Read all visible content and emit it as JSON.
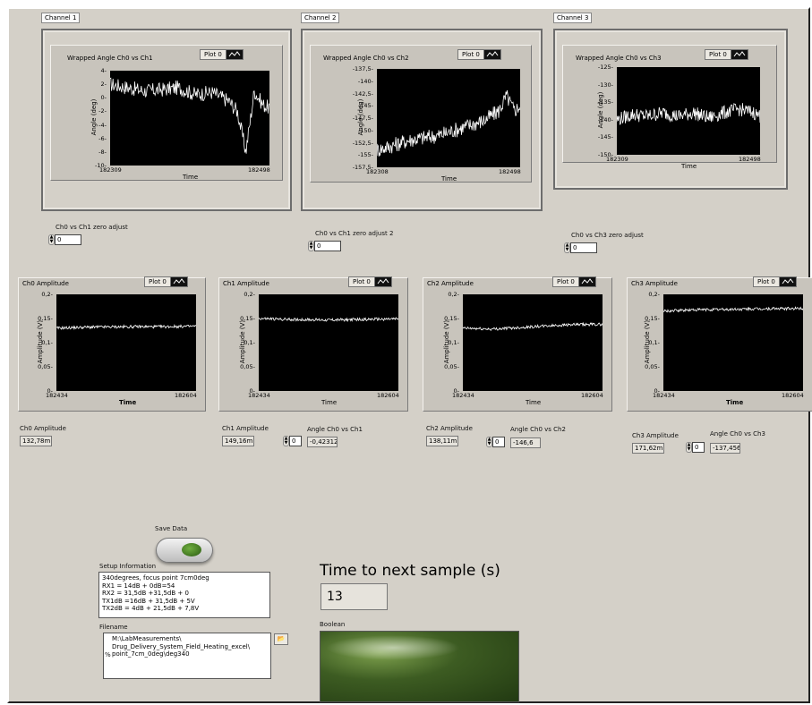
{
  "channels": [
    {
      "label": "Channel 1",
      "graph_title": "Wrapped Angle Ch0 vs Ch1",
      "plot_legend": "Plot 0",
      "ylabel": "Angle (deg)",
      "xlabel": "Time",
      "yticks": [
        "4",
        "2",
        "0",
        "-2",
        "-4",
        "-6",
        "-8",
        "-10"
      ],
      "xticks": [
        "182309",
        "182498"
      ],
      "zero_label": "Ch0 vs Ch1 zero adjust",
      "zero_value": "0"
    },
    {
      "label": "Channel 2",
      "graph_title": "Wrapped Angle Ch0 vs Ch2",
      "plot_legend": "Plot 0",
      "ylabel": "Angle (deg)",
      "xlabel": "Time",
      "yticks": [
        "-137,5",
        "-140",
        "-142,5",
        "-145",
        "-147,5",
        "-150",
        "-152,5",
        "-155",
        "-157,5"
      ],
      "xticks": [
        "182308",
        "182498"
      ],
      "zero_label": "Ch0 vs Ch1 zero adjust 2",
      "zero_value": "0"
    },
    {
      "label": "Channel 3",
      "graph_title": "Wrapped Angle Ch0 vs Ch3",
      "plot_legend": "Plot 0",
      "ylabel": "Angle (deg)",
      "xlabel": "Time",
      "yticks": [
        "-125",
        "-130",
        "-135",
        "-140",
        "-145",
        "-150"
      ],
      "xticks": [
        "182309",
        "182498"
      ],
      "zero_label": "Ch0 vs Ch3 zero adjust",
      "zero_value": "0"
    }
  ],
  "amplitudes": [
    {
      "graph_title": "Ch0 Amplitude",
      "plot_legend": "Plot 0",
      "ylabel": "Amplitude (V)",
      "xlabel": "Time",
      "yticks": [
        "0,2",
        "0,15",
        "0,1",
        "0,05",
        "0"
      ],
      "xticks": [
        "182434",
        "182604"
      ],
      "indicator_label": "Ch0 Amplitude",
      "indicator_value": "132,78m"
    },
    {
      "graph_title": "Ch1 Amplitude",
      "plot_legend": "Plot 0",
      "ylabel": "Amplitude (V)",
      "xlabel": "Time",
      "yticks": [
        "0,2",
        "0,15",
        "0,1",
        "0,05",
        "0"
      ],
      "xticks": [
        "182434",
        "182604"
      ],
      "indicator_label": "Ch1 Amplitude",
      "indicator_value": "149,16m",
      "angle_label": "Angle Ch0 vs Ch1",
      "angle_ctl": "0",
      "angle_value": "-0,42312"
    },
    {
      "graph_title": "Ch2 Amplitude",
      "plot_legend": "Plot 0",
      "ylabel": "Amplitude (V)",
      "xlabel": "Time",
      "yticks": [
        "0,2",
        "0,15",
        "0,1",
        "0,05",
        "0"
      ],
      "xticks": [
        "182434",
        "182604"
      ],
      "indicator_label": "Ch2 Amplitude",
      "indicator_value": "138,11m",
      "angle_label": "Angle Ch0 vs Ch2",
      "angle_ctl": "0",
      "angle_value": "-146,6"
    },
    {
      "graph_title": "Ch3 Amplitude",
      "plot_legend": "Plot 0",
      "ylabel": "Amplitude (V)",
      "xlabel": "Time",
      "yticks": [
        "0,2",
        "0,15",
        "0,1",
        "0,05",
        "0"
      ],
      "xticks": [
        "182434",
        "182604"
      ],
      "indicator_label": "Ch3 Amplitude",
      "indicator_value": "171,62m",
      "angle_label": "Angle Ch0 vs Ch3",
      "angle_ctl": "0",
      "angle_value": "-137,456"
    }
  ],
  "save_data": {
    "label": "Save Data"
  },
  "setup": {
    "label": "Setup Information",
    "text": "340degrees, focus point 7cm0deg\nRX1 = 14dB + 0dB=54\nRX2 = 31,5dB +31,5dB + 0\nTX1dB =16dB + 31,5dB + 5V\nTX2dB = 4dB + 21,5dB + 7,8V"
  },
  "filename": {
    "label": "Filename",
    "text": "M:\\LabMeasurements\\\nDrug_Delivery_System_Field_Heating_excel\\\npoint_7cm_0deg\\deg340",
    "prefix": "%"
  },
  "time_to_next": {
    "label": "Time to next sample (s)",
    "value": "13"
  },
  "boolean": {
    "label": "Boolean"
  },
  "chart_data": [
    {
      "type": "line",
      "title": "Wrapped Angle Ch0 vs Ch1",
      "xlabel": "Time",
      "ylabel": "Angle (deg)",
      "xlim": [
        182309,
        182498
      ],
      "ylim": [
        -10,
        4
      ],
      "series": [
        {
          "x": [
            182309,
            182330,
            182350,
            182370,
            182390,
            182410,
            182430,
            182450,
            182460,
            182470,
            182480,
            182490,
            182498
          ],
          "values": [
            2,
            1.5,
            1,
            1.2,
            1.5,
            0.5,
            0.8,
            -0.5,
            -2,
            -8,
            1,
            -1,
            -1.5
          ]
        }
      ]
    },
    {
      "type": "line",
      "title": "Wrapped Angle Ch0 vs Ch2",
      "xlabel": "Time",
      "ylabel": "Angle (deg)",
      "xlim": [
        182308,
        182498
      ],
      "ylim": [
        -157.5,
        -137.5
      ],
      "series": [
        {
          "x": [
            182308,
            182330,
            182350,
            182370,
            182390,
            182410,
            182430,
            182450,
            182470,
            182480,
            182490,
            182498
          ],
          "values": [
            -154,
            -153,
            -152,
            -151.5,
            -151,
            -150,
            -149,
            -148,
            -146,
            -143,
            -146,
            -145
          ]
        }
      ]
    },
    {
      "type": "line",
      "title": "Wrapped Angle Ch0 vs Ch3",
      "xlabel": "Time",
      "ylabel": "Angle (deg)",
      "xlim": [
        182309,
        182498
      ],
      "ylim": [
        -150,
        -125
      ],
      "series": [
        {
          "x": [
            182309,
            182330,
            182350,
            182370,
            182390,
            182410,
            182430,
            182450,
            182470,
            182490,
            182498
          ],
          "values": [
            -140,
            -138.5,
            -139,
            -138,
            -139,
            -138,
            -139.5,
            -138,
            -137,
            -138,
            -139
          ]
        }
      ]
    },
    {
      "type": "line",
      "title": "Ch0 Amplitude",
      "xlabel": "Time",
      "ylabel": "Amplitude (V)",
      "xlim": [
        182434,
        182604
      ],
      "ylim": [
        0,
        0.2
      ],
      "series": [
        {
          "x": [
            182434,
            182470,
            182520,
            182560,
            182604
          ],
          "values": [
            0.13,
            0.132,
            0.133,
            0.133,
            0.134
          ]
        }
      ]
    },
    {
      "type": "line",
      "title": "Ch1 Amplitude",
      "xlabel": "Time",
      "ylabel": "Amplitude (V)",
      "xlim": [
        182434,
        182604
      ],
      "ylim": [
        0,
        0.2
      ],
      "series": [
        {
          "x": [
            182434,
            182470,
            182520,
            182560,
            182604
          ],
          "values": [
            0.15,
            0.148,
            0.147,
            0.148,
            0.149
          ]
        }
      ]
    },
    {
      "type": "line",
      "title": "Ch2 Amplitude",
      "xlabel": "Time",
      "ylabel": "Amplitude (V)",
      "xlim": [
        182434,
        182604
      ],
      "ylim": [
        0,
        0.2
      ],
      "series": [
        {
          "x": [
            182434,
            182470,
            182520,
            182560,
            182604
          ],
          "values": [
            0.13,
            0.128,
            0.133,
            0.137,
            0.138
          ]
        }
      ]
    },
    {
      "type": "line",
      "title": "Ch3 Amplitude",
      "xlabel": "Time",
      "ylabel": "Amplitude (V)",
      "xlim": [
        182434,
        182604
      ],
      "ylim": [
        0,
        0.2
      ],
      "series": [
        {
          "x": [
            182434,
            182470,
            182520,
            182560,
            182604
          ],
          "values": [
            0.165,
            0.168,
            0.169,
            0.17,
            0.171
          ]
        }
      ]
    }
  ]
}
